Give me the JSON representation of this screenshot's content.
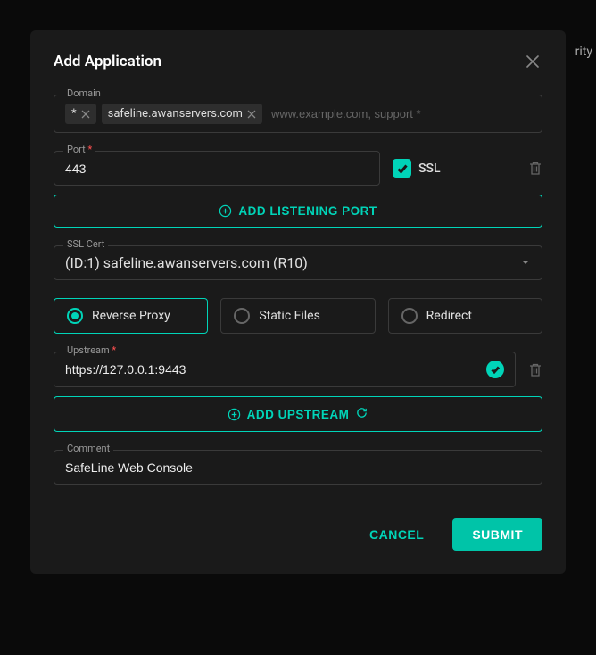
{
  "bg": {
    "partial_text": "rity"
  },
  "modal": {
    "title": "Add Application",
    "domain": {
      "legend": "Domain",
      "chips": [
        "*",
        "safeline.awanservers.com"
      ],
      "placeholder": "www.example.com, support *"
    },
    "port": {
      "legend": "Port",
      "value": "443",
      "ssl_label": "SSL",
      "ssl_checked": true
    },
    "add_listening_port_label": "ADD LISTENING PORT",
    "ssl_cert": {
      "legend": "SSL Cert",
      "value": "(ID:1) safeline.awanservers.com (R10)"
    },
    "proxy_type": {
      "options": [
        "Reverse Proxy",
        "Static Files",
        "Redirect"
      ],
      "selected": "Reverse Proxy"
    },
    "upstream": {
      "legend": "Upstream",
      "value": "https://127.0.0.1:9443"
    },
    "add_upstream_label": "ADD UPSTREAM",
    "comment": {
      "legend": "Comment",
      "value": "SafeLine Web Console"
    },
    "cancel_label": "CANCEL",
    "submit_label": "SUBMIT"
  }
}
